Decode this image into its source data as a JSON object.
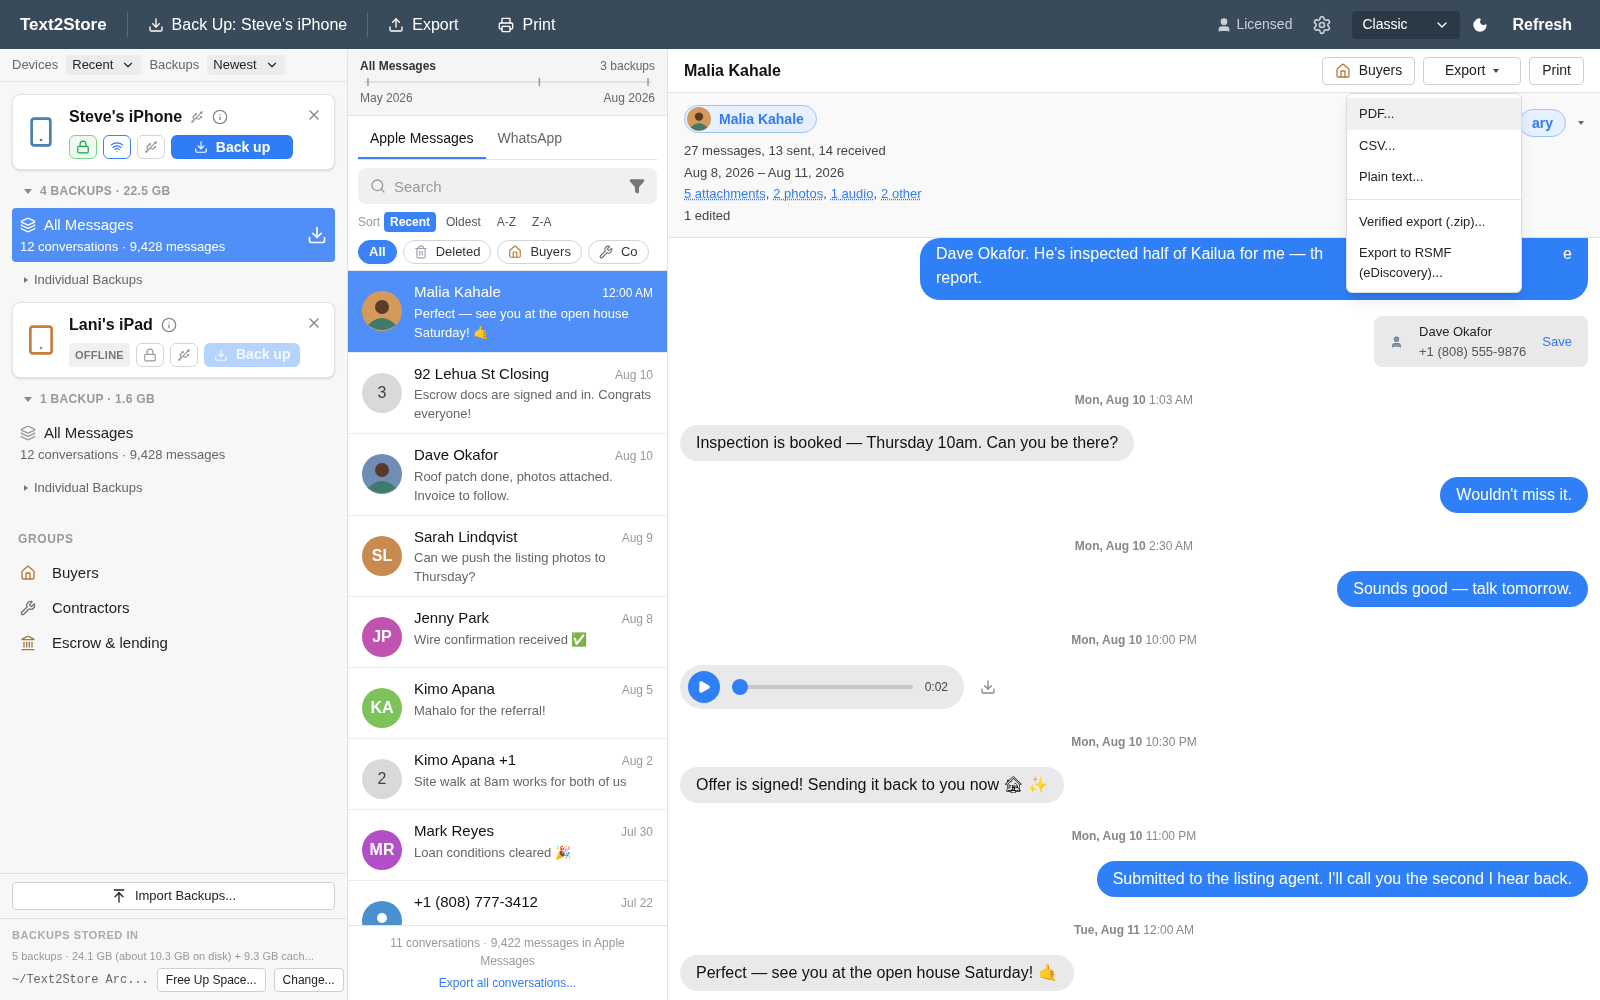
{
  "topbar": {
    "app_name": "Text2Store",
    "actions": [
      {
        "kind": "download",
        "label": "Back Up: Steve's iPhone"
      },
      {
        "kind": "upload",
        "label": "Export"
      },
      {
        "kind": "print",
        "label": "Print"
      }
    ],
    "license": "Licensed",
    "theme": "Classic",
    "refresh": "Refresh"
  },
  "sidebar": {
    "filters": [
      {
        "label": "Devices",
        "value": "Recent"
      },
      {
        "label": "Backups",
        "value": "Newest"
      }
    ],
    "devices": [
      {
        "name": "Steve's iPhone",
        "kind": "phone",
        "connected": true,
        "badges": [
          {
            "kind": "lock",
            "active": true
          },
          {
            "kind": "wifi",
            "active": true
          },
          {
            "kind": "usb",
            "active": false
          }
        ],
        "backup_button": {
          "label": "Back up",
          "disabled": false
        },
        "summary": "4 BACKUPS · 22.5 GB",
        "collection": {
          "title": "All Messages",
          "detail": "12 conversations · 9,428 messages",
          "selected": true
        },
        "individual": "Individual Backups"
      },
      {
        "name": "Lani's iPad",
        "kind": "tablet",
        "connected": false,
        "offline_label": "OFFLINE",
        "badges": [
          {
            "kind": "lock",
            "active": false
          },
          {
            "kind": "usb",
            "active": false
          }
        ],
        "backup_button": {
          "label": "Back up",
          "disabled": true
        },
        "summary": "1 BACKUP · 1.6 GB",
        "collection": {
          "title": "All Messages",
          "detail": "12 conversations · 9,428 messages",
          "selected": false
        },
        "individual": "Individual Backups"
      }
    ],
    "groups_title": "GROUPS",
    "groups": [
      {
        "kind": "house",
        "label": "Buyers"
      },
      {
        "kind": "wrench",
        "label": "Contractors"
      },
      {
        "kind": "bank",
        "label": "Escrow & lending"
      }
    ],
    "import_button": "Import Backups...",
    "storage_title": "BACKUPS STORED IN",
    "storage_detail": "5 backups · 24.1 GB (about 10.3 GB on disk) + 9.3 GB cach...",
    "storage_path": "~/Text2Store Arc...",
    "storage_buttons": [
      "Free Up Space...",
      "Change..."
    ]
  },
  "conversations": {
    "timeline": {
      "title": "All Messages",
      "count": "3 backups",
      "start": "May 2026",
      "end": "Aug 2026"
    },
    "tabs": [
      {
        "label": "Apple Messages",
        "selected": true
      },
      {
        "label": "WhatsApp",
        "selected": false
      }
    ],
    "search": {
      "placeholder": "Search"
    },
    "sort_label": "Sort",
    "sort_options": [
      {
        "label": "Recent",
        "selected": true
      },
      {
        "label": "Oldest",
        "selected": false
      },
      {
        "label": "A-Z",
        "selected": false
      },
      {
        "label": "Z-A",
        "selected": false
      }
    ],
    "chips": [
      {
        "kind": "plain",
        "label": "All",
        "selected": true
      },
      {
        "kind": "trash",
        "label": "Deleted",
        "selected": false
      },
      {
        "kind": "house",
        "label": "Buyers",
        "selected": false
      },
      {
        "kind": "wrench",
        "label": "Co",
        "selected": false
      }
    ],
    "items": [
      {
        "name": "Malia Kahale",
        "time": "12:00 AM",
        "preview": "Perfect — see you at the open house Saturday! 🤙",
        "avatar": {
          "kind": "photo",
          "color": "#d49a5c"
        },
        "selected": true
      },
      {
        "name": "92 Lehua St Closing",
        "time": "Aug 10",
        "preview": "Escrow docs are signed and in. Congrats everyone!",
        "avatar": {
          "kind": "count",
          "text": "3",
          "color": "#d9d9d9"
        },
        "selected": false
      },
      {
        "name": "Dave Okafor",
        "time": "Aug 10",
        "preview": "Roof patch done, photos attached. Invoice to follow.",
        "avatar": {
          "kind": "photo",
          "color": "#6f8db5"
        },
        "selected": false
      },
      {
        "name": "Sarah Lindqvist",
        "time": "Aug 9",
        "preview": "Can we push the listing photos to Thursday?",
        "avatar": {
          "kind": "initials",
          "text": "SL",
          "color": "#c98a4f"
        },
        "selected": false
      },
      {
        "name": "Jenny Park",
        "time": "Aug 8",
        "preview": "Wire confirmation received ✅",
        "avatar": {
          "kind": "initials",
          "text": "JP",
          "color": "#c153b0"
        },
        "selected": false
      },
      {
        "name": "Kimo Apana",
        "time": "Aug 5",
        "preview": "Mahalo for the referral!",
        "avatar": {
          "kind": "initials",
          "text": "KA",
          "color": "#7cc35a"
        },
        "selected": false
      },
      {
        "name": "Kimo Apana +1",
        "time": "Aug 2",
        "preview": "Site walk at 8am works for both of us",
        "avatar": {
          "kind": "count",
          "text": "2",
          "color": "#d9d9d9"
        },
        "selected": false
      },
      {
        "name": "Mark Reyes",
        "time": "Jul 30",
        "preview": "Loan conditions cleared 🎉",
        "avatar": {
          "kind": "initials",
          "text": "MR",
          "color": "#b24fc6"
        },
        "selected": false
      },
      {
        "name": "+1 (808) 777-3412",
        "time": "Jul 22",
        "avatar": {
          "kind": "unknown",
          "color": "#4a8fd0"
        },
        "selected": false
      }
    ],
    "footer": "11 conversations · 9,422 messages in Apple Messages",
    "export_link": "Export all conversations..."
  },
  "chat": {
    "title": "Malia Kahale",
    "header_buttons": [
      {
        "kind": "house",
        "label": "Buyers"
      },
      {
        "kind": "menu",
        "label": "Export"
      },
      {
        "kind": "plain",
        "label": "Print"
      }
    ],
    "contact_chip": "Malia Kahale",
    "stats": [
      "27 messages, 13 sent, 14 received",
      "Aug 8, 2026 – Aug 11, 2026"
    ],
    "attachment_links": [
      "5 attachments",
      "2 photos",
      "1 audio",
      "2 other"
    ],
    "link_separator": ",",
    "edited": "1 edited",
    "side_pill": "ary",
    "export_menu": [
      {
        "kind": "item",
        "label": "PDF...",
        "selected": true
      },
      {
        "kind": "item",
        "label": "CSV...",
        "selected": false
      },
      {
        "kind": "item",
        "label": "Plain text...",
        "selected": false
      },
      {
        "kind": "divider"
      },
      {
        "kind": "item",
        "label": "Verified export (.zip)...",
        "selected": false
      },
      {
        "kind": "item",
        "label": "Export to RSMF (eDiscovery)...",
        "selected": false
      }
    ],
    "messages": [
      {
        "kind": "outgoing_covered",
        "parts": [
          "Dave Okafor. He's inspected half of Kailua for me — th",
          "e",
          "report."
        ]
      },
      {
        "kind": "contact",
        "name": "Dave Okafor",
        "phone": "+1 (808) 555-9876",
        "action": "Save"
      },
      {
        "kind": "date",
        "text": "**Mon, Aug 10** 1:03 AM"
      },
      {
        "kind": "incoming",
        "text": "Inspection is booked — Thursday 10am. Can you be there?"
      },
      {
        "kind": "outgoing",
        "text": "Wouldn't miss it."
      },
      {
        "kind": "date",
        "text": "**Mon, Aug 10** 2:30 AM"
      },
      {
        "kind": "outgoing",
        "text": "Sounds good — talk tomorrow."
      },
      {
        "kind": "date",
        "text": "**Mon, Aug 10** 10:00 PM"
      },
      {
        "kind": "audio",
        "duration": "0:02",
        "level": 0
      },
      {
        "kind": "date",
        "text": "**Mon, Aug 10** 10:30 PM"
      },
      {
        "kind": "incoming",
        "text": "Offer is signed! Sending it back to you now 🏚 ✨"
      },
      {
        "kind": "date",
        "text": "**Mon, Aug 10** 11:00 PM"
      },
      {
        "kind": "outgoing",
        "text": "Submitted to the listing agent. I'll call you the second I hear back."
      },
      {
        "kind": "date",
        "text": "**Tue, Aug 11** 12:00 AM"
      },
      {
        "kind": "incoming",
        "text": "Perfect — see you at the open house Saturday! 🤙"
      }
    ]
  }
}
